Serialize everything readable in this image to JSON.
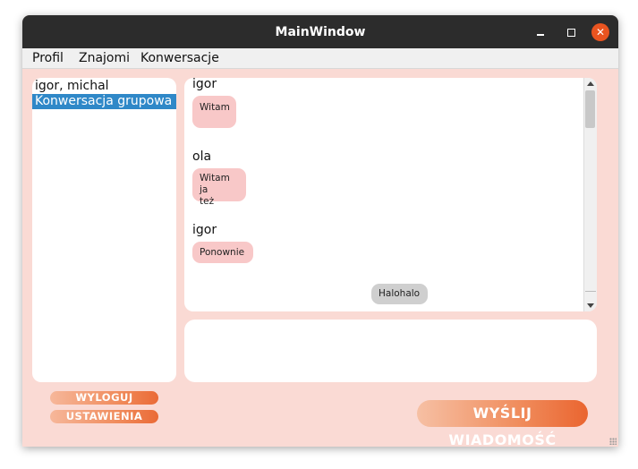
{
  "window": {
    "title": "MainWindow"
  },
  "titlebar": {
    "minimize_icon": "minimize-icon",
    "maximize_icon": "maximize-icon",
    "close_icon": "close-icon",
    "close_glyph": "✕",
    "close_color": "#e95420"
  },
  "menubar": {
    "items": [
      {
        "label": "Profil"
      },
      {
        "label": "Znajomi"
      },
      {
        "label": "Konwersacje"
      }
    ]
  },
  "conversations": {
    "items": [
      {
        "label": "igor, michal",
        "selected": false
      },
      {
        "label": "Konwersacja grupowa",
        "selected": true
      }
    ],
    "selected_color": "#2f88c8"
  },
  "chat": {
    "messages": [
      {
        "sender": "igor",
        "text": "Witam",
        "own": false
      },
      {
        "sender": "ola",
        "text": "Witam ja\nteż",
        "own": false
      },
      {
        "sender": "igor",
        "text": "Ponownie",
        "own": false
      },
      {
        "sender": "",
        "text": "Halohalo",
        "own": true
      }
    ],
    "bubble_color": "#f8c8c8",
    "own_bubble_color": "#cfcfcf"
  },
  "compose": {
    "value": "",
    "placeholder": ""
  },
  "buttons": {
    "logout_label": "WYLOGUJ",
    "settings_label": "USTAWIENIA",
    "send_label": "WYŚLIJ WIADOMOŚĆ",
    "accent_color": "#ea6530"
  },
  "colors": {
    "window_bg": "#fadad4",
    "titlebar_bg": "#2c2c2c"
  }
}
